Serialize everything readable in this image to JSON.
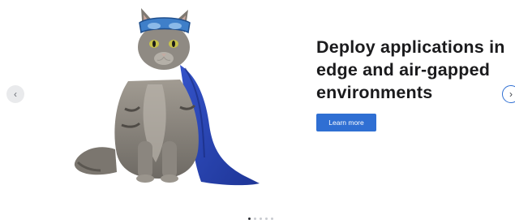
{
  "carousel": {
    "slide": {
      "title": "Deploy applications in edge and air-gapped environments",
      "cta_label": "Learn more",
      "image_subject": "cat-in-blue-superhero-cape-and-mask"
    },
    "nav": {
      "prev_icon": "chevron-left-icon",
      "prev_glyph": "‹",
      "next_icon": "chevron-right-icon",
      "next_glyph": "›"
    },
    "dots": {
      "count": 5,
      "active_index": 0
    }
  },
  "colors": {
    "accent": "#2f6fd3",
    "title": "#1a1a1c",
    "cape": "#2a48b8",
    "mask": "#3f7fc9",
    "fur": "#8e8a84"
  }
}
